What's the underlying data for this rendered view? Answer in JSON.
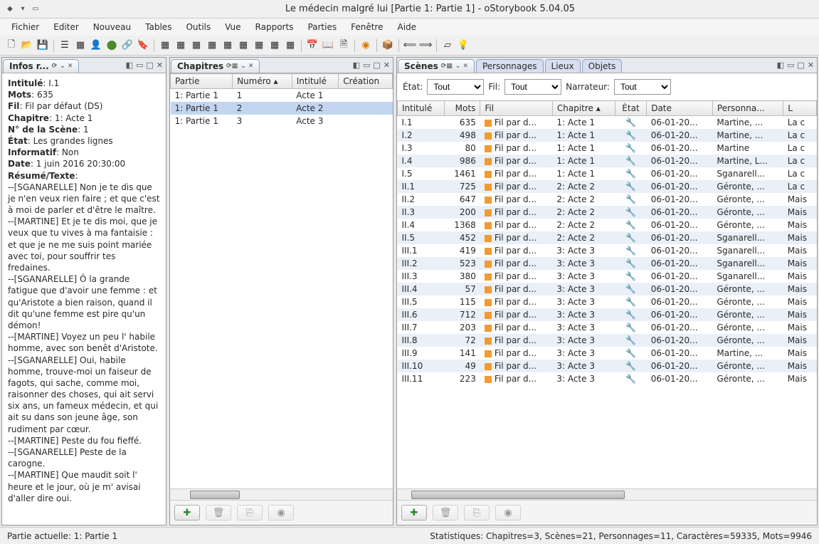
{
  "window": {
    "title": "Le médecin malgré lui [Partie 1: Partie 1] - oStorybook 5.04.05"
  },
  "menu": {
    "items": [
      "Fichier",
      "Editer",
      "Nouveau",
      "Tables",
      "Outils",
      "Vue",
      "Rapports",
      "Parties",
      "Fenêtre",
      "Aide"
    ]
  },
  "panels": {
    "info": {
      "title": "Infos r..."
    },
    "chapters": {
      "title": "Chapitres"
    },
    "scenes": {
      "title": "Scènes"
    },
    "characters": {
      "title": "Personnages"
    },
    "locations": {
      "title": "Lieux"
    },
    "objects": {
      "title": "Objets"
    }
  },
  "info": {
    "labels": {
      "intitule": "Intitulé",
      "mots": "Mots",
      "fil": "Fil",
      "chapitre": "Chapitre",
      "numscene": "N° de la Scène",
      "etat": "État",
      "informatif": "Informatif",
      "date": "Date",
      "resume": "Résumé/Texte"
    },
    "intitule": "I.1",
    "mots": "635",
    "fil": "Fil par défaut (DS)",
    "chapitre": "1: Acte 1",
    "numscene": "1",
    "etat": "Les grandes lignes",
    "informatif": "Non",
    "date": "1 juin 2016 20:30:00",
    "resume": "--[SGANARELLE] Non je te dis que je n'en veux rien faire ; et que c'est à moi de parler et d'être le maître.\n--[MARTINE] Et je te dis moi, que je veux que tu vives à ma fantaisie : et que je ne me suis point mariée avec toi, pour souffrir tes fredaines.\n--[SGANARELLE] Ô la grande fatigue que d'avoir une femme : et qu'Aristote a bien raison, quand il dit qu'une femme est pire qu'un démon!\n--[MARTINE] Voyez un peu l' habile homme, avec son benêt d'Aristote.\n--[SGANARELLE] Oui, habile homme, trouve-moi un faiseur de fagots, qui sache, comme moi, raisonner des choses, qui ait servi six ans, un fameux médecin, et qui ait su dans son jeune âge, son rudiment par cœur.\n--[MARTINE] Peste du fou fieffé.\n--[SGANARELLE] Peste de la carogne.\n--[MARTINE] Que maudit soit l' heure et le jour, où je m' avisai d'aller dire oui."
  },
  "chapters": {
    "headers": {
      "partie": "Partie",
      "numero": "Numéro",
      "intitule": "Intitulé",
      "creation": "Création"
    },
    "rows": [
      {
        "partie": "1: Partie 1",
        "numero": "1",
        "intitule": "Acte 1"
      },
      {
        "partie": "1: Partie 1",
        "numero": "2",
        "intitule": "Acte 2"
      },
      {
        "partie": "1: Partie 1",
        "numero": "3",
        "intitule": "Acte 3"
      }
    ]
  },
  "filters": {
    "etat_label": "État:",
    "fil_label": "Fil:",
    "narr_label": "Narrateur:",
    "etat": "Tout",
    "fil": "Tout",
    "narr": "Tout"
  },
  "scenes": {
    "headers": {
      "intitule": "Intitulé",
      "mots": "Mots",
      "fil": "Fil",
      "chapitre": "Chapitre",
      "etat": "État",
      "date": "Date",
      "personnages": "Personna...",
      "l": "L"
    },
    "rows": [
      {
        "int": "I.1",
        "mots": "635",
        "fil": "Fil par d...",
        "ch": "1: Acte 1",
        "date": "06-01-20...",
        "pers": "Martine, ...",
        "l": "La c"
      },
      {
        "int": "I.2",
        "mots": "498",
        "fil": "Fil par d...",
        "ch": "1: Acte 1",
        "date": "06-01-20...",
        "pers": "Martine, ...",
        "l": "La c"
      },
      {
        "int": "I.3",
        "mots": "80",
        "fil": "Fil par d...",
        "ch": "1: Acte 1",
        "date": "06-01-20...",
        "pers": "Martine",
        "l": "La c"
      },
      {
        "int": "I.4",
        "mots": "986",
        "fil": "Fil par d...",
        "ch": "1: Acte 1",
        "date": "06-01-20...",
        "pers": "Martine, L...",
        "l": "La c"
      },
      {
        "int": "I.5",
        "mots": "1461",
        "fil": "Fil par d...",
        "ch": "1: Acte 1",
        "date": "06-01-20...",
        "pers": "Sganarell...",
        "l": "La c"
      },
      {
        "int": "II.1",
        "mots": "725",
        "fil": "Fil par d...",
        "ch": "2: Acte 2",
        "date": "06-01-20...",
        "pers": "Géronte, ...",
        "l": "La c"
      },
      {
        "int": "II.2",
        "mots": "647",
        "fil": "Fil par d...",
        "ch": "2: Acte 2",
        "date": "06-01-20...",
        "pers": "Géronte, ...",
        "l": "Mais"
      },
      {
        "int": "II.3",
        "mots": "200",
        "fil": "Fil par d...",
        "ch": "2: Acte 2",
        "date": "06-01-20...",
        "pers": "Géronte, ...",
        "l": "Mais"
      },
      {
        "int": "II.4",
        "mots": "1368",
        "fil": "Fil par d...",
        "ch": "2: Acte 2",
        "date": "06-01-20...",
        "pers": "Géronte, ...",
        "l": "Mais"
      },
      {
        "int": "II.5",
        "mots": "452",
        "fil": "Fil par d...",
        "ch": "2: Acte 2",
        "date": "06-01-20...",
        "pers": "Sganarell...",
        "l": "Mais"
      },
      {
        "int": "III.1",
        "mots": "419",
        "fil": "Fil par d...",
        "ch": "3: Acte 3",
        "date": "06-01-20...",
        "pers": "Sganarell...",
        "l": "Mais"
      },
      {
        "int": "III.2",
        "mots": "523",
        "fil": "Fil par d...",
        "ch": "3: Acte 3",
        "date": "06-01-20...",
        "pers": "Sganarell...",
        "l": "Mais"
      },
      {
        "int": "III.3",
        "mots": "380",
        "fil": "Fil par d...",
        "ch": "3: Acte 3",
        "date": "06-01-20...",
        "pers": "Sganarell...",
        "l": "Mais"
      },
      {
        "int": "III.4",
        "mots": "57",
        "fil": "Fil par d...",
        "ch": "3: Acte 3",
        "date": "06-01-20...",
        "pers": "Géronte, ...",
        "l": "Mais"
      },
      {
        "int": "III.5",
        "mots": "115",
        "fil": "Fil par d...",
        "ch": "3: Acte 3",
        "date": "06-01-20...",
        "pers": "Géronte, ...",
        "l": "Mais"
      },
      {
        "int": "III.6",
        "mots": "712",
        "fil": "Fil par d...",
        "ch": "3: Acte 3",
        "date": "06-01-20...",
        "pers": "Géronte, ...",
        "l": "Mais"
      },
      {
        "int": "III.7",
        "mots": "203",
        "fil": "Fil par d...",
        "ch": "3: Acte 3",
        "date": "06-01-20...",
        "pers": "Géronte, ...",
        "l": "Mais"
      },
      {
        "int": "III.8",
        "mots": "72",
        "fil": "Fil par d...",
        "ch": "3: Acte 3",
        "date": "06-01-20...",
        "pers": "Géronte, ...",
        "l": "Mais"
      },
      {
        "int": "III.9",
        "mots": "141",
        "fil": "Fil par d...",
        "ch": "3: Acte 3",
        "date": "06-01-20...",
        "pers": "Martine, ...",
        "l": "Mais"
      },
      {
        "int": "III.10",
        "mots": "49",
        "fil": "Fil par d...",
        "ch": "3: Acte 3",
        "date": "06-01-20...",
        "pers": "Géronte, ...",
        "l": "Mais"
      },
      {
        "int": "III.11",
        "mots": "223",
        "fil": "Fil par d...",
        "ch": "3: Acte 3",
        "date": "06-01-20...",
        "pers": "Géronte, ...",
        "l": "Mais"
      }
    ]
  },
  "status": {
    "left": "Partie actuelle: 1: Partie 1",
    "right": "Statistiques: Chapitres=3,  Scènes=21,  Personnages=11,  Caractères=59335,  Mots=9946"
  }
}
